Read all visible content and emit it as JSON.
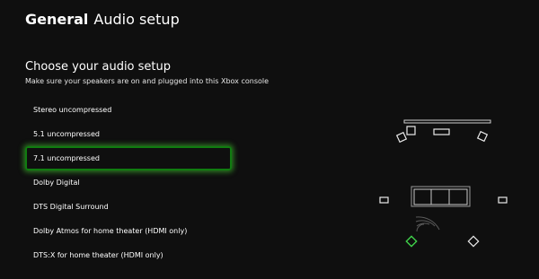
{
  "header": {
    "section": "General",
    "title": "Audio setup"
  },
  "main": {
    "heading": "Choose your audio setup",
    "subheading": "Make sure your speakers are on and plugged into this Xbox console",
    "options": [
      "Stereo uncompressed",
      "5.1 uncompressed",
      "7.1 uncompressed",
      "Dolby Digital",
      "DTS Digital Surround",
      "Dolby Atmos for home theater (HDMI only)",
      "DTS:X for home theater (HDMI only)"
    ],
    "selected_option": "7.1 uncompressed"
  },
  "colors": {
    "background": "#0f0f0f",
    "focus_border": "#107c10",
    "focus_glow": "#46d232",
    "highlight_speaker": "#3fd14a"
  },
  "diagram": {
    "icons": [
      "tv-icon",
      "speaker-icon",
      "sofa-icon",
      "sound-wave-icon"
    ]
  }
}
